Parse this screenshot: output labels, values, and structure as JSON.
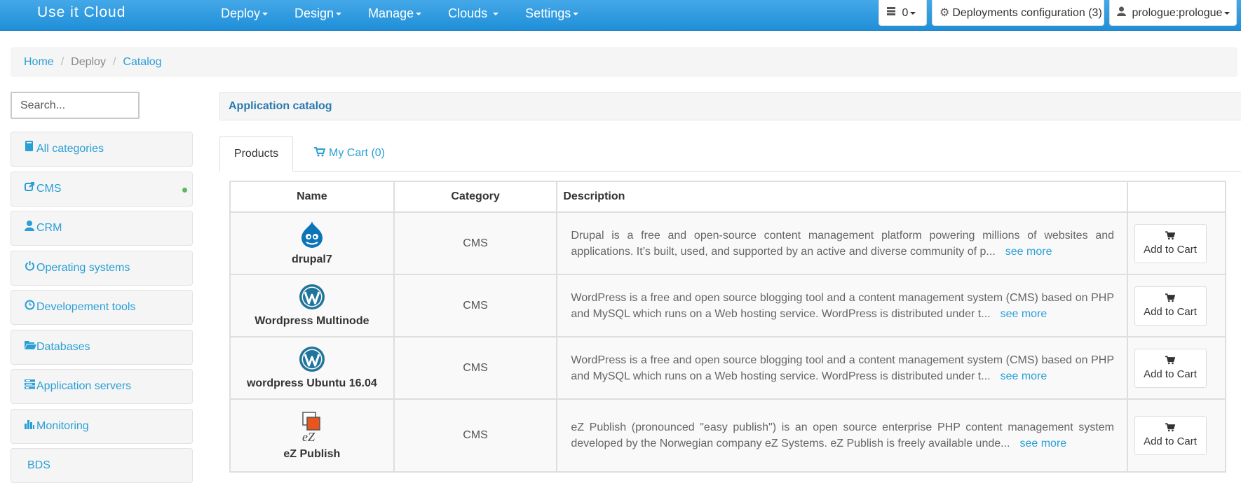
{
  "navbar": {
    "brand": "Use it Cloud",
    "menu": [
      "Deploy",
      "Design",
      "Manage",
      "Clouds",
      "Settings"
    ],
    "server_count": "0",
    "deployments_config": "Deployments configuration (3)",
    "user": "prologue:prologue"
  },
  "breadcrumb": [
    "Home",
    "Deploy",
    "Catalog"
  ],
  "sidebar": {
    "search_placeholder": "Search...",
    "categories": [
      {
        "label": "All categories",
        "icon": "book-icon"
      },
      {
        "label": "CMS",
        "icon": "external-link-icon",
        "active": true
      },
      {
        "label": "CRM",
        "icon": "user-icon"
      },
      {
        "label": "Operating systems",
        "icon": "power-icon"
      },
      {
        "label": "Developement tools",
        "icon": "clock-icon"
      },
      {
        "label": "Databases",
        "icon": "folder-open-icon"
      },
      {
        "label": "Application servers",
        "icon": "tasks-icon"
      },
      {
        "label": "Monitoring",
        "icon": "stats-icon"
      },
      {
        "label": "BDS",
        "icon": ""
      }
    ]
  },
  "panel": {
    "title": "Application catalog",
    "tabs": {
      "products": "Products",
      "cart": "My Cart (0)"
    },
    "columns": [
      "Name",
      "Category",
      "Description",
      ""
    ],
    "rows": [
      {
        "name": "drupal7",
        "category": "CMS",
        "logo": "drupal-logo",
        "description": "Drupal is a free and open-source content management platform powering millions of websites and applications. It’s built, used, and supported by an active and diverse community of p...",
        "see_more": "see more",
        "action": "Add to Cart"
      },
      {
        "name": "Wordpress Multinode",
        "category": "CMS",
        "logo": "wordpress-logo",
        "description": "WordPress is a free and open source blogging tool and a content management system (CMS) based on PHP and MySQL which runs on a Web hosting service. WordPress is distributed under t...",
        "see_more": "see more",
        "action": "Add to Cart"
      },
      {
        "name": "wordpress Ubuntu 16.04",
        "category": "CMS",
        "logo": "wordpress-logo",
        "description": "WordPress is a free and open source blogging tool and a content management system (CMS) based on PHP and MySQL which runs on a Web hosting service. WordPress is distributed under t...",
        "see_more": "see more",
        "action": "Add to Cart"
      },
      {
        "name": "eZ Publish",
        "category": "CMS",
        "logo": "ez-publish-logo",
        "description": "eZ Publish (pronounced \"easy publish\") is an open source enterprise PHP content management system developed by the Norwegian company eZ Systems. eZ Publish is freely available unde...",
        "see_more": "see more",
        "action": "Add to Cart"
      }
    ]
  },
  "colors": {
    "navbar": "#2196dd",
    "link": "#2a9fd6",
    "active_dot": "#5cb85c",
    "panel_title": "#2a7ab0"
  }
}
